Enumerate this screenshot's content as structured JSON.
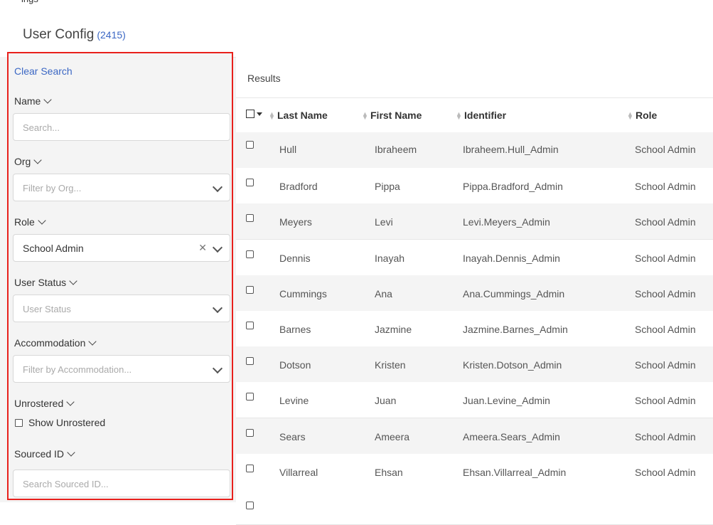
{
  "top_fragment": "ings",
  "header": {
    "title": "User Config",
    "count": "(2415)"
  },
  "sidebar": {
    "clear_search": "Clear Search",
    "filters": {
      "name": {
        "label": "Name",
        "placeholder": "Search..."
      },
      "org": {
        "label": "Org",
        "placeholder": "Filter by Org..."
      },
      "role": {
        "label": "Role",
        "value": "School Admin"
      },
      "user_status": {
        "label": "User Status",
        "placeholder": "User Status"
      },
      "accommodation": {
        "label": "Accommodation",
        "placeholder": "Filter by Accommodation..."
      },
      "unrostered": {
        "label": "Unrostered",
        "checkbox_label": "Show Unrostered"
      },
      "sourced_id": {
        "label": "Sourced ID",
        "placeholder": "Search Sourced ID..."
      }
    }
  },
  "results": {
    "label": "Results",
    "columns": [
      "Last Name",
      "First Name",
      "Identifier",
      "Role"
    ],
    "rows": [
      [
        "Hull",
        "Ibraheem",
        "Ibraheem.Hull_Admin",
        "School Admin"
      ],
      [
        "Bradford",
        "Pippa",
        "Pippa.Bradford_Admin",
        "School Admin"
      ],
      [
        "Meyers",
        "Levi",
        "Levi.Meyers_Admin",
        "School Admin"
      ],
      [
        "Dennis",
        "Inayah",
        "Inayah.Dennis_Admin",
        "School Admin"
      ],
      [
        "Cummings",
        "Ana",
        "Ana.Cummings_Admin",
        "School Admin"
      ],
      [
        "Barnes",
        "Jazmine",
        "Jazmine.Barnes_Admin",
        "School Admin"
      ],
      [
        "Dotson",
        "Kristen",
        "Kristen.Dotson_Admin",
        "School Admin"
      ],
      [
        "Levine",
        "Juan",
        "Juan.Levine_Admin",
        "School Admin"
      ],
      [
        "Sears",
        "Ameera",
        "Ameera.Sears_Admin",
        "School Admin"
      ],
      [
        "Villarreal",
        "Ehsan",
        "Ehsan.Villarreal_Admin",
        "School Admin"
      ]
    ]
  },
  "colors": {
    "accent": "#3b67c4",
    "highlight_border": "#e8201c",
    "row_alt": "#f4f4f4"
  }
}
